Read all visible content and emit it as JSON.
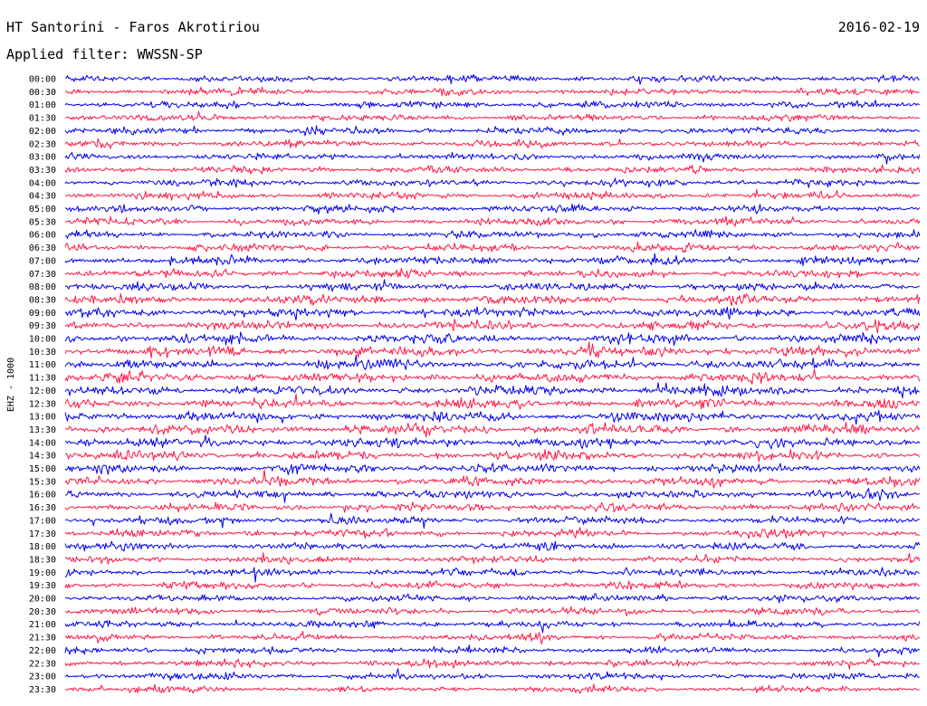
{
  "header": {
    "station": "HT Santorini - Faros Akrotiriou",
    "date": "2016-02-19",
    "filter": "Applied filter: WWSSN-SP",
    "channel": "EHZ - 1000"
  },
  "colors": {
    "trace_a": "#0000ee",
    "trace_b": "#ff1744",
    "background": "#ffffff",
    "text": "#000000"
  },
  "chart_data": {
    "type": "line",
    "title": "HT Santorini - Faros Akrotiriou",
    "ylabel": "EHZ - 1000",
    "rows": [
      "00:00",
      "00:30",
      "01:00",
      "01:30",
      "02:00",
      "02:30",
      "03:00",
      "03:30",
      "04:00",
      "04:30",
      "05:00",
      "05:30",
      "06:00",
      "06:30",
      "07:00",
      "07:30",
      "08:00",
      "08:30",
      "09:00",
      "09:30",
      "10:00",
      "10:30",
      "11:00",
      "11:30",
      "12:00",
      "12:30",
      "13:00",
      "13:30",
      "14:00",
      "14:30",
      "15:00",
      "15:30",
      "16:00",
      "16:30",
      "17:00",
      "17:30",
      "18:00",
      "18:30",
      "19:00",
      "19:30",
      "20:00",
      "20:30",
      "21:00",
      "21:30",
      "22:00",
      "22:30",
      "23:00",
      "23:30"
    ],
    "series": [
      {
        "color": "#0000ee"
      },
      {
        "color": "#ff1744"
      }
    ],
    "grid": false,
    "legend": "none"
  }
}
